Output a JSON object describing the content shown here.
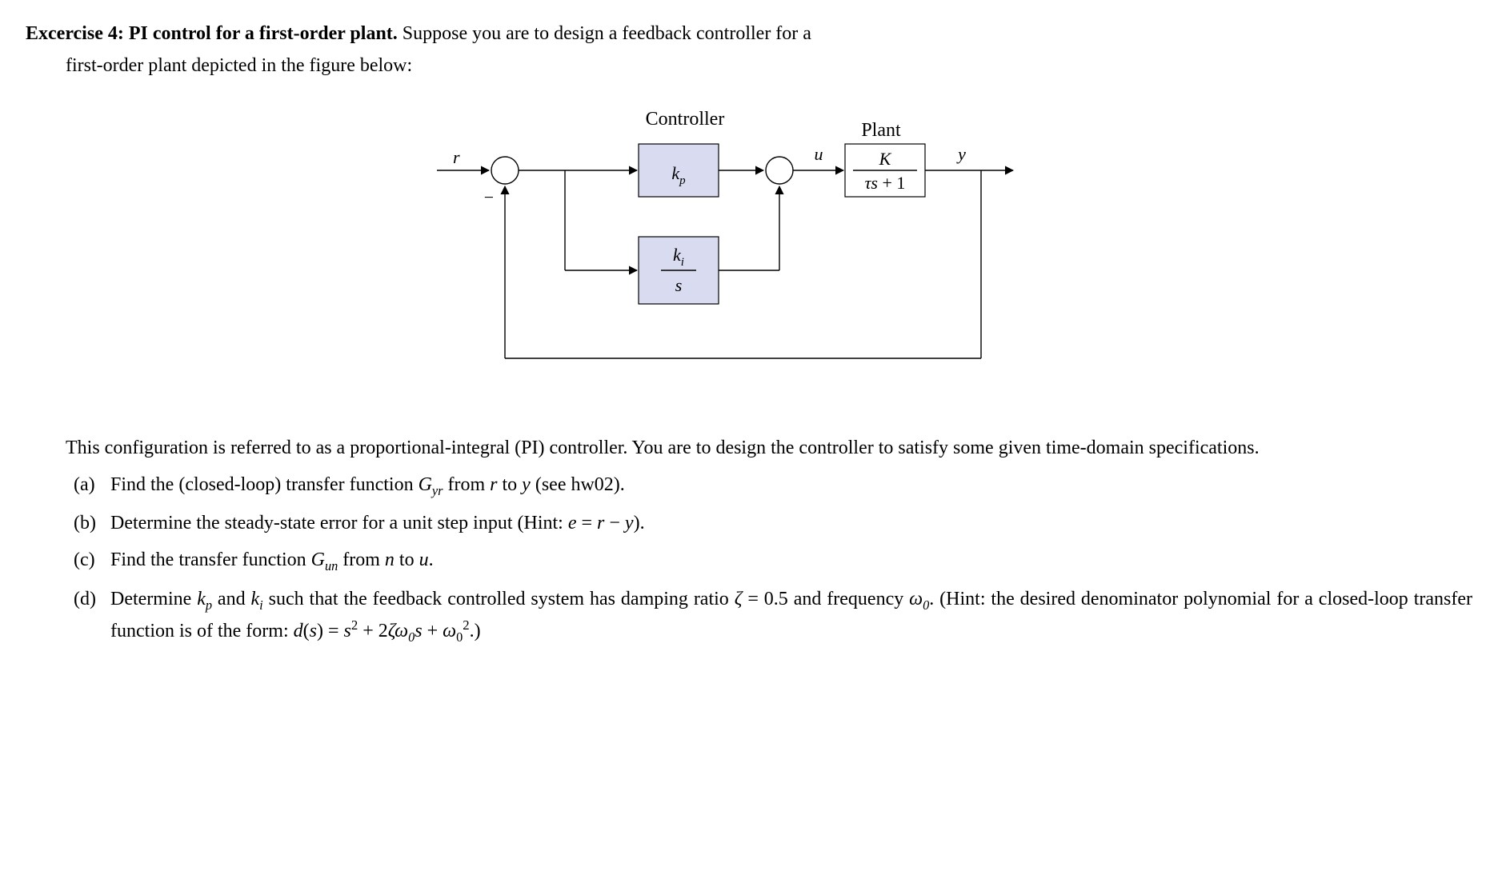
{
  "exercise": {
    "label": "Excercise 4: PI control for a first-order plant.",
    "intro1": " Suppose you are to design a feedback controller for a",
    "intro2": "first-order plant depicted in the figure below:"
  },
  "body": {
    "para": "This configuration is referred to as a proportional-integral (PI) controller. You are to design the controller to satisfy some given time-domain specifications."
  },
  "items": [
    {
      "label": "(a)",
      "html": "Find the (closed-loop) transfer function <span class='math-i'>G<span class='sub'>yr</span></span> from <span class='math-i'>r</span> to <span class='math-i'>y</span> (see hw02)."
    },
    {
      "label": "(b)",
      "html": "Determine the steady-state error for a unit step input (Hint: <span class='math-i'>e</span> = <span class='math-i'>r</span> − <span class='math-i'>y</span>)."
    },
    {
      "label": "(c)",
      "html": "Find the transfer function <span class='math-i'>G<span class='sub'>un</span></span> from <span class='math-i'>n</span> to <span class='math-i'>u</span>."
    },
    {
      "label": "(d)",
      "html": "Determine <span class='math-i'>k<span class='sub'>p</span></span> and <span class='math-i'>k<span class='sub'>i</span></span> such that the feedback controlled system has damping ratio <span class='math-i'>ζ</span> = 0.5 and frequency <span class='math-i'>ω</span><span class='sub'>0</span>. (Hint: the desired denominator polynomial for a closed-loop transfer function is of the form: <span class='math-i'>d</span>(<span class='math-i'>s</span>) = <span class='math-i'>s</span><span class='sup'>2</span> + 2<span class='math-i'>ζω</span><span class='sub'>0</span><span class='math-i'>s</span> + <span class='math-i'>ω</span><span class='sub' style='font-style:normal'>0</span><span class='sup'>2</span>.)"
    }
  ],
  "diagram": {
    "controller_label": "Controller",
    "plant_label": "Plant",
    "r": "r",
    "u": "u",
    "y": "y",
    "kp": "k",
    "kp_sub": "p",
    "ki": "k",
    "ki_sub": "i",
    "s": "s",
    "K": "K",
    "tau": "τs",
    "plus1": " + 1",
    "minus": "−"
  }
}
